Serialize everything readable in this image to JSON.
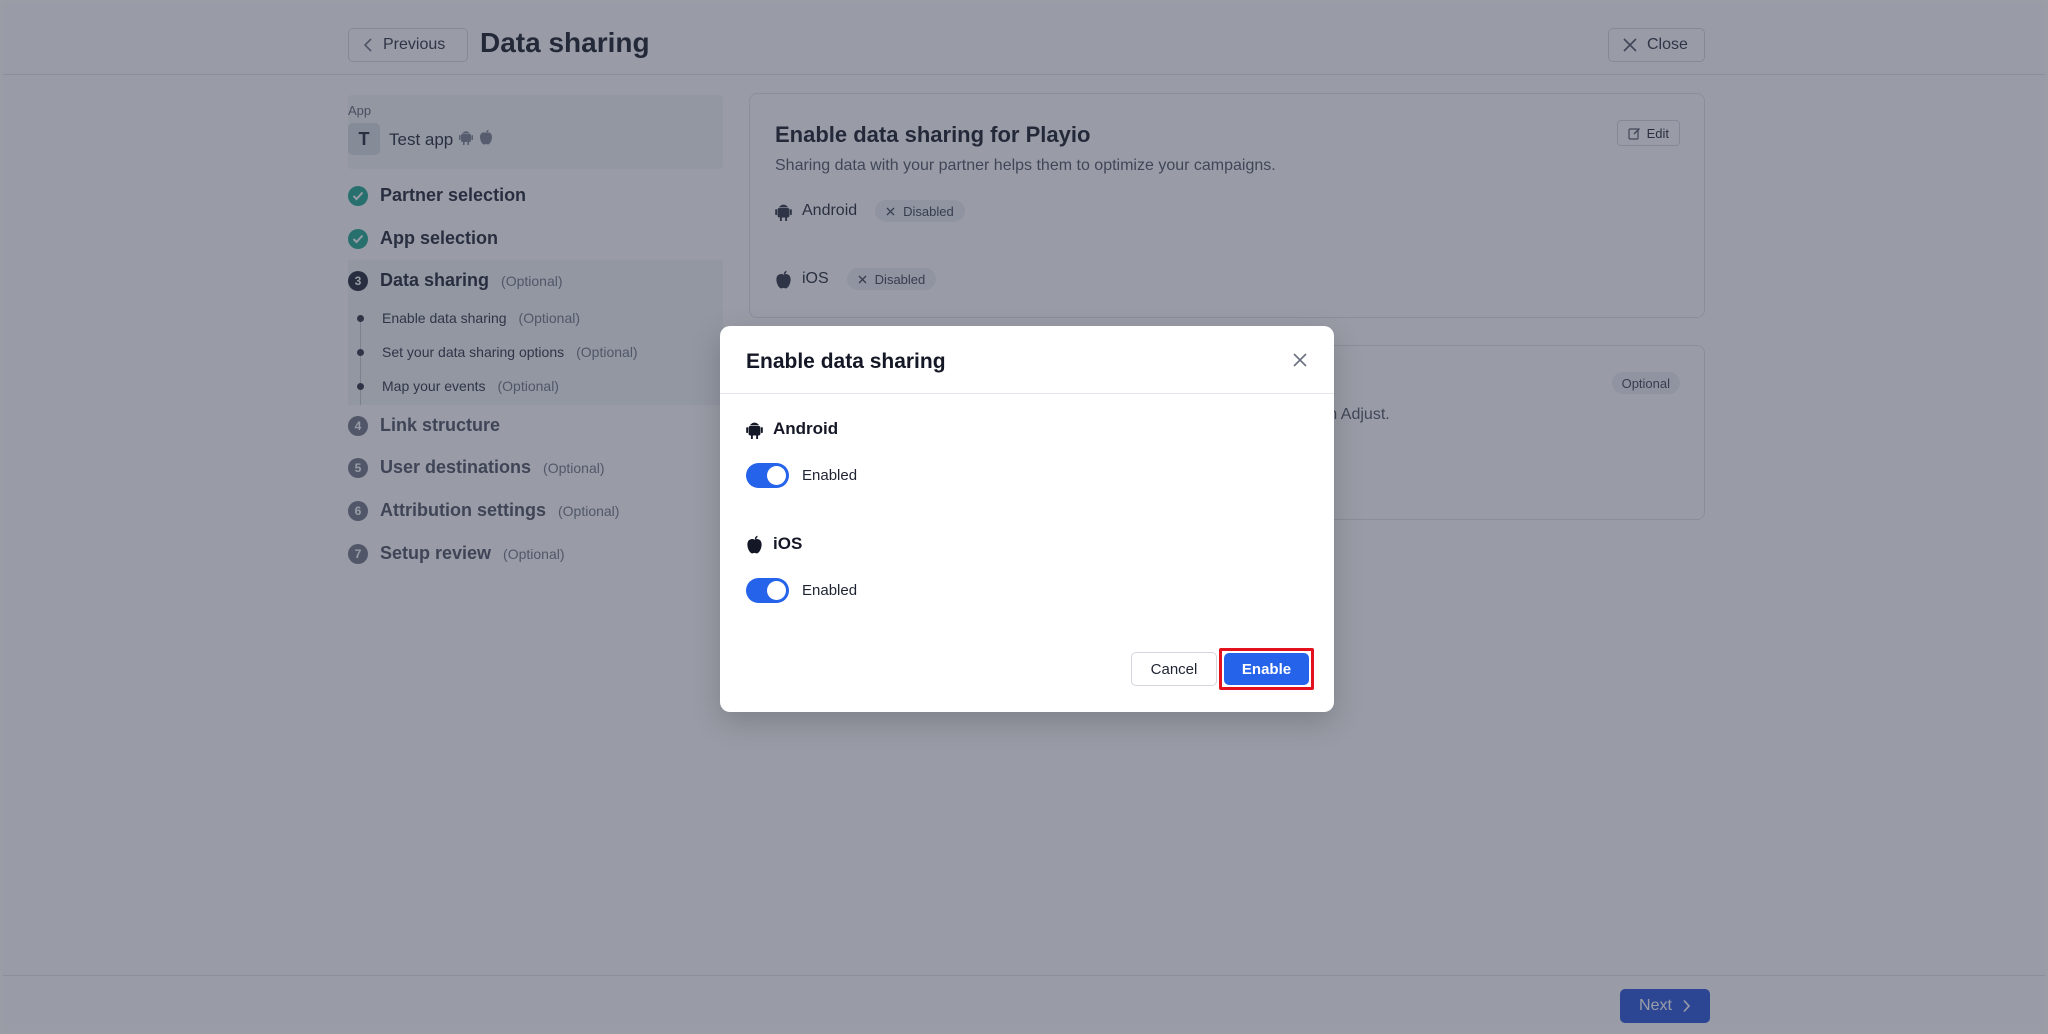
{
  "header": {
    "previous_label": "Previous",
    "title": "Data sharing",
    "close_label": "Close"
  },
  "sidebar": {
    "app_label": "App",
    "app_avatar_letter": "T",
    "app_name": "Test app",
    "steps": [
      {
        "number": "1",
        "label": "Partner selection",
        "optional": "",
        "state": "done"
      },
      {
        "number": "2",
        "label": "App selection",
        "optional": "",
        "state": "done"
      },
      {
        "number": "3",
        "label": "Data sharing",
        "optional": "(Optional)",
        "state": "current"
      },
      {
        "number": "4",
        "label": "Link structure",
        "optional": "",
        "state": "todo"
      },
      {
        "number": "5",
        "label": "User destinations",
        "optional": "(Optional)",
        "state": "todo"
      },
      {
        "number": "6",
        "label": "Attribution settings",
        "optional": "(Optional)",
        "state": "todo"
      },
      {
        "number": "7",
        "label": "Setup review",
        "optional": "(Optional)",
        "state": "todo"
      }
    ],
    "substeps": [
      {
        "label": "Enable data sharing",
        "optional": "(Optional)"
      },
      {
        "label": "Set your data sharing options",
        "optional": "(Optional)"
      },
      {
        "label": "Map your events",
        "optional": "(Optional)"
      }
    ]
  },
  "main": {
    "card1": {
      "title": "Enable data sharing for Playio",
      "description": "Sharing data with your partner helps them to optimize your campaigns.",
      "edit_label": "Edit",
      "platforms": [
        {
          "name": "Android",
          "status": "Disabled"
        },
        {
          "name": "iOS",
          "status": "Disabled"
        }
      ]
    },
    "card2": {
      "optional_badge": "Optional",
      "partial_text": "om Adjust."
    }
  },
  "footer": {
    "next_label": "Next"
  },
  "modal": {
    "title": "Enable data sharing",
    "platforms": [
      {
        "name": "Android",
        "toggle_label": "Enabled",
        "enabled": true
      },
      {
        "name": "iOS",
        "toggle_label": "Enabled",
        "enabled": true
      }
    ],
    "cancel_label": "Cancel",
    "enable_label": "Enable"
  },
  "colors": {
    "accent": "#2563eb",
    "success": "#1aa68f",
    "highlight": "#e3101e"
  }
}
